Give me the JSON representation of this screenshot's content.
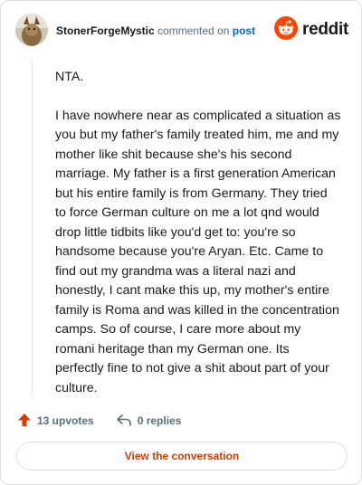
{
  "header": {
    "username": "StonerForgeMystic",
    "commented_text": "commented on",
    "post_link": "post",
    "brand": "reddit"
  },
  "comment": {
    "paragraphs": [
      "NTA.",
      "I have nowhere near as complicated a situation as you but my father's family treated him, me and my mother like shit because she's his second marriage. My father is a first generation American but his entire family is from Germany. They tried to force German culture on me a lot qnd would drop little tidbits like you'd get to: you're so handsome because you're Aryan. Etc. Came to find out my grandma was a literal nazi and honestly, I cant make this up, my mother's entire family is Roma and was killed in the concentration camps. So of course, I care more about my romani heritage than my German one. Its perfectly fine to not give a shit about part of your culture."
    ]
  },
  "actions": {
    "upvotes": "13 upvotes",
    "replies": "0 replies"
  },
  "cta": {
    "label": "View the conversation"
  },
  "colors": {
    "brand_orange": "#ff4500",
    "upvote": "#d93900",
    "link_blue": "#0a65c2",
    "muted": "#576f76"
  }
}
